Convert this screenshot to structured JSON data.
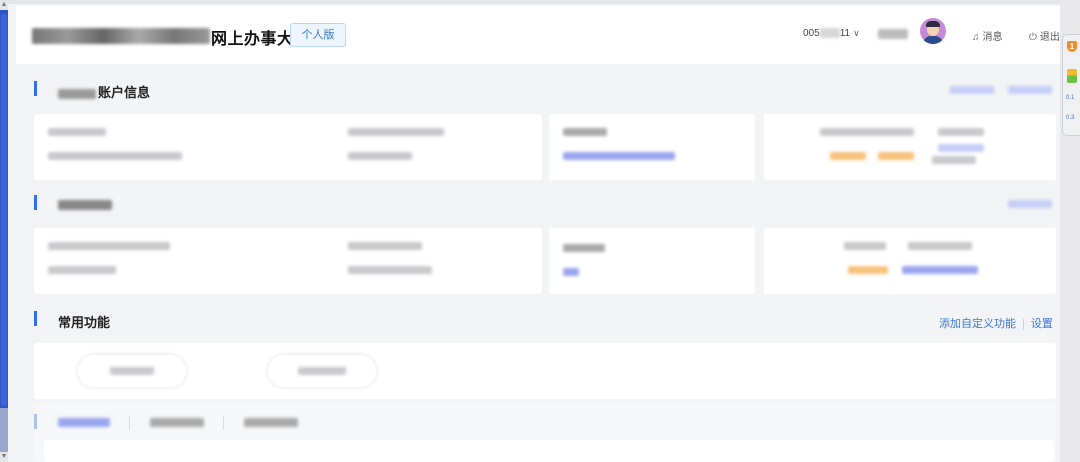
{
  "header": {
    "title_suffix": "网上办事大厅",
    "edition_badge": "个人版",
    "account_prefix": "005",
    "account_suffix": "11",
    "messages_label": "消息",
    "logout_label": "退出"
  },
  "sections": {
    "account_info": {
      "title_suffix": "账户信息"
    },
    "common_functions": {
      "title": "常用功能",
      "add_custom_label": "添加自定义功能",
      "settings_label": "设置"
    }
  },
  "sidebar_widget": {
    "badge_count": "1",
    "stat_1": "0.1",
    "stat_2": "0.3"
  },
  "colors": {
    "accent": "#2f6ff0",
    "link": "#3f76db",
    "badge_bg": "#edf5ff",
    "left_scrollbar": "#2e56c7"
  },
  "icons": {
    "messages": "bell-icon",
    "logout": "power-icon",
    "account_dropdown": "chevron-down-icon",
    "security": "shield-icon"
  }
}
